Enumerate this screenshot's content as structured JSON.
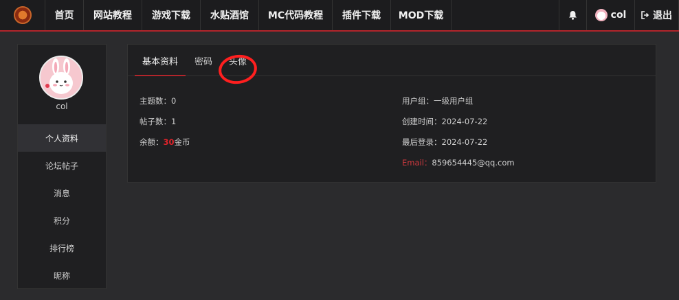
{
  "navbar": {
    "items": [
      "首页",
      "网站教程",
      "游戏下载",
      "水贴酒馆",
      "MC代码教程",
      "插件下载",
      "MOD下载"
    ],
    "user_label": "col",
    "logout_label": "退出",
    "icons": {
      "bell": "bell-icon",
      "logout": "logout-icon",
      "logo": "site-logo"
    }
  },
  "sidebar": {
    "username": "col",
    "items": [
      "个人资料",
      "论坛帖子",
      "消息",
      "积分",
      "排行榜",
      "昵称"
    ],
    "active_index": 0
  },
  "profile": {
    "tabs": [
      "基本资料",
      "密码",
      "头像"
    ],
    "active_tab": "基本资料",
    "topics_label": "主题数：",
    "topics_value": "0",
    "posts_label": "帖子数：",
    "posts_value": "1",
    "balance_label": "余额：",
    "balance_value": "30",
    "balance_unit": "金币",
    "group_label": "用户组：",
    "group_value": "一级用户组",
    "created_label": "创建时间：",
    "created_value": "2024-07-22",
    "last_login_label": "最后登录：",
    "last_login_value": "2024-07-22",
    "email_label": "Email：",
    "email_value": "859654445@qq.com"
  },
  "colors": {
    "accent": "#b3252b",
    "annotation": "#ff1f1f",
    "background": "#2b2b2d",
    "panel": "#1f1f21"
  }
}
